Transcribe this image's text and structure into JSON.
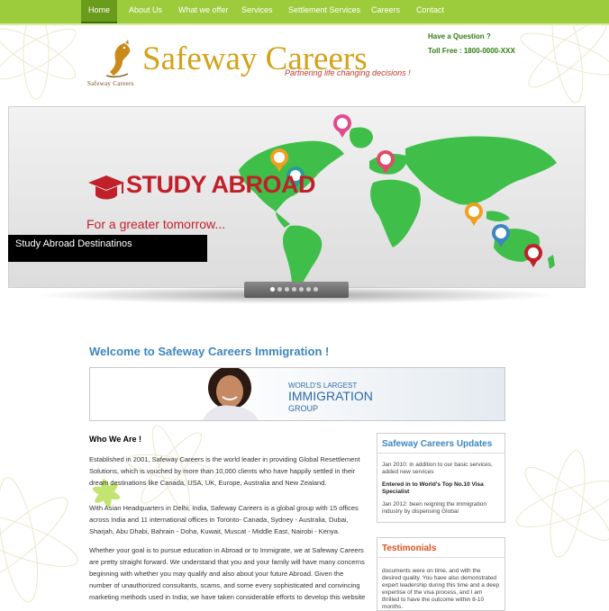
{
  "nav": {
    "items": [
      {
        "label": "Home",
        "active": true
      },
      {
        "label": "About Us"
      },
      {
        "label": "What we offer"
      },
      {
        "label": "Services"
      },
      {
        "label": "Settlement Services"
      },
      {
        "label": "Careers"
      },
      {
        "label": "Contact"
      }
    ]
  },
  "header": {
    "brand": "Safeway Careers",
    "tagline": "Partnering life changing decisions !",
    "logo_text": "Safeway Careers",
    "question": "Have a Question ?",
    "toll_free": "Toll Free : 1800-0000-XXX"
  },
  "slider": {
    "heading": "STUDY ABROAD",
    "subheading": "For a greater tomorrow...",
    "caption": "Study Abroad Destinatinos",
    "total_slides": 7,
    "active_slide": 1
  },
  "content": {
    "welcome": "Welcome to Safeway Careers Immigration !",
    "banner": {
      "line1": "WORLD'S LARGEST",
      "line2": "IMMIGRATION",
      "line3": "GROUP"
    },
    "who_we_are": "Who We Are !",
    "paragraphs": [
      "Established in 2001, Safeway Careers is the world leader in providing Global Resettlement Solutions, which is vouched by more than 10,000 clients who have happily settled in their dream destinations like Canada, USA, UK, Europe, Australia and New Zealand.",
      "With Asian Headquarters in Delhi, India, Safeway Careers is a global group with 15 offices across India and 11 international offices in Toronto- Canada, Sydney - Australia, Dubai, Sharjah, Abu Dhabi, Bahrain - Doha, Kuwait, Muscat - Middle East, Nairobi - Kenya.",
      "Whether your goal is to pursue education in Abroad or to Immigrate, we at Safeway Careers are pretty straight forward. We understand that you and your family will have many concerns beginning with whether you may qualify and also about your future Abroad. Given the number of unauthorized consultants, scams, and some every sophisticated and convincing marketing methods used in India; we have taken considerable efforts to develop this website with much"
    ]
  },
  "sidebar": {
    "updates": {
      "title": "Safeway Careers Updates",
      "items": [
        {
          "text": "Jan 2010: in addition to our basic services, added new services",
          "bold": false
        },
        {
          "text": "Entered in to World's Top No.10 Visa Specialist",
          "bold": true
        },
        {
          "text": "Jan 2012: been reigning the immigration industry by dispensing Global",
          "bold": false
        }
      ]
    },
    "testimonials": {
      "title": "Testimonials",
      "text": "documents were on time, and with the desired quality. You have also demonstrated expert leadership during this time and a deep expertise of the visa process, and I am thrilled to have the outcome within 8-10 months."
    }
  },
  "colors": {
    "nav_green": "#9ccc3c",
    "brand_gold": "#d3a21a",
    "welcome_blue": "#3d86c0",
    "study_red": "#c0202a",
    "map_green": "#3fbf4a",
    "testimonial_orange": "#d9531e"
  }
}
